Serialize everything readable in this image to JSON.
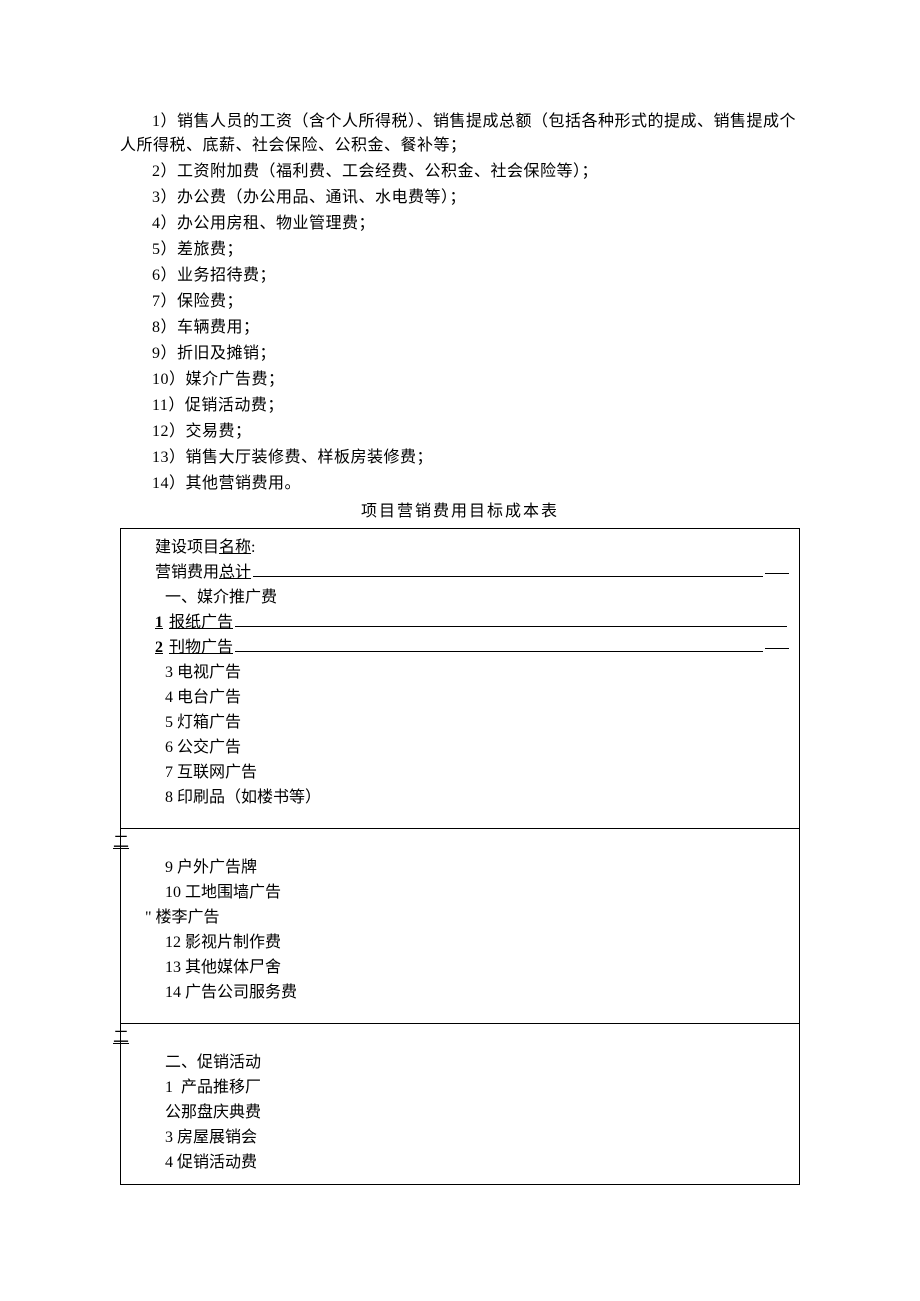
{
  "list": {
    "i1": "1）销售人员的工资（含个人所得税）、销售提成总额（包括各种形式的提成、销售提成个人所得税、底薪、社会保险、公积金、餐补等；",
    "i2": "2）工资附加费（福利费、工会经费、公积金、社会保险等）；",
    "i3": "3）办公费（办公用品、通讯、水电费等）；",
    "i4": "4）办公用房租、物业管理费；",
    "i5": "5）差旅费；",
    "i6": "6）业务招待费；",
    "i7": "7）保险费；",
    "i8": "8）车辆费用；",
    "i9": "9）折旧及摊销；",
    "i10": "10）媒介广告费；",
    "i11": "11）促销活动费；",
    "i12": "12）交易费；",
    "i13": "13）销售大厅装修费、样板房装修费；",
    "i14": "14）其他营销费用。"
  },
  "table_title": "项目营销费用目标成本表",
  "table": {
    "proj_label": "建设项目",
    "proj_label_u": "名称",
    "total_label": "营销费用",
    "total_label_u": "总计",
    "sec1": "一、媒介推广费",
    "items1": {
      "n1": "1",
      "t1": "报纸广告",
      "n2": "2",
      "t2": "刊物广告",
      "n3": "3",
      "t3": "电视广告",
      "n4": "4",
      "t4": "电台广告",
      "n5": "5",
      "t5": "灯箱广告",
      "n6": "6",
      "t6": "公交广告",
      "n7": "7",
      "t7": "互联网广告",
      "n8": "8",
      "t8": "印刷品（如楼书等）"
    },
    "two_mark": "二",
    "items2": {
      "n9": "9",
      "t9": "户外广告牌",
      "n10": "10",
      "t10": "工地围墙广告",
      "q11": "\"",
      "t11": "楼李广告",
      "n12": "12",
      "t12": "影视片制作费",
      "n13": "13",
      "t13": "其他媒体尸舍",
      "n14": "14",
      "t14": "广告公司服务费"
    },
    "sec2": "二、促销活动",
    "items3": {
      "n1b": "1",
      "t1b": "产品推移厂",
      "t_gong": "公那盘庆典费",
      "n3b": "3",
      "t3b": "房屋展销会",
      "n4b": "4",
      "t4b": "促销活动费"
    }
  }
}
